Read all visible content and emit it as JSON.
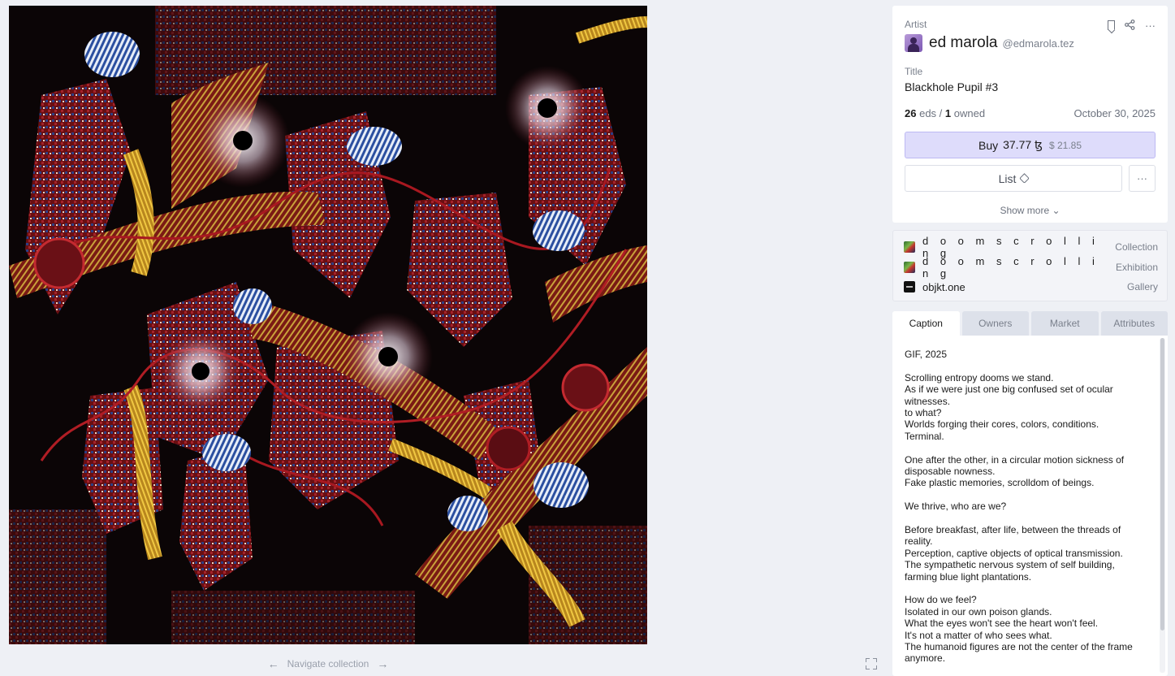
{
  "artwork": {
    "alt": "Blackhole Pupil #3"
  },
  "navigation": {
    "label": "Navigate collection",
    "prev_icon": "arrow-left-icon",
    "next_icon": "arrow-right-icon",
    "fullscreen_icon": "fullscreen-icon"
  },
  "artist": {
    "label": "Artist",
    "name": "ed marola",
    "handle": "@edmarola.tez",
    "icons": [
      "bookmark-icon",
      "share-icon",
      "more-icon"
    ]
  },
  "token": {
    "title_label": "Title",
    "title": "Blackhole Pupil #3",
    "editions_count": "26",
    "editions_label": "eds /",
    "owned_count": "1",
    "owned_label": "owned",
    "date": "October 30, 2025"
  },
  "actions": {
    "buy_label": "Buy",
    "buy_price": "37.77 ꜩ",
    "buy_usd": "$ 21.85",
    "list_label": "List",
    "more_label": "···",
    "show_more": "Show more"
  },
  "links": [
    {
      "name": "d o o m s c r o l l i n g",
      "type": "Collection"
    },
    {
      "name": "d o o m s c r o l l i n g",
      "type": "Exhibition"
    },
    {
      "name": "objkt.one",
      "type": "Gallery"
    }
  ],
  "tabs": [
    "Caption",
    "Owners",
    "Market",
    "Attributes"
  ],
  "active_tab": "Caption",
  "caption": [
    "GIF, 2025",
    "Scrolling entropy dooms we stand.\nAs if we were just one big confused set of ocular witnesses.\nto what?\nWorlds forging their cores, colors, conditions.\nTerminal.",
    "One after the other, in a circular motion sickness of disposable nowness.\nFake plastic memories, scrolldom of beings.",
    "We thrive, who are we?",
    "Before breakfast, after life, between the threads of reality.\nPerception, captive objects of optical transmission.\nThe sympathetic nervous system of self building, farming blue light plantations.",
    "How do we feel?\nIsolated in our own poison glands.\nWhat the eyes won't see the heart won't feel.\nIt's not a matter of who sees what.\nThe humanoid figures are not the center of the frame anymore."
  ],
  "colors": {
    "accent_bg": "#dedcfb",
    "accent_border": "#bdb9f3",
    "page_bg": "#eef0f5"
  }
}
